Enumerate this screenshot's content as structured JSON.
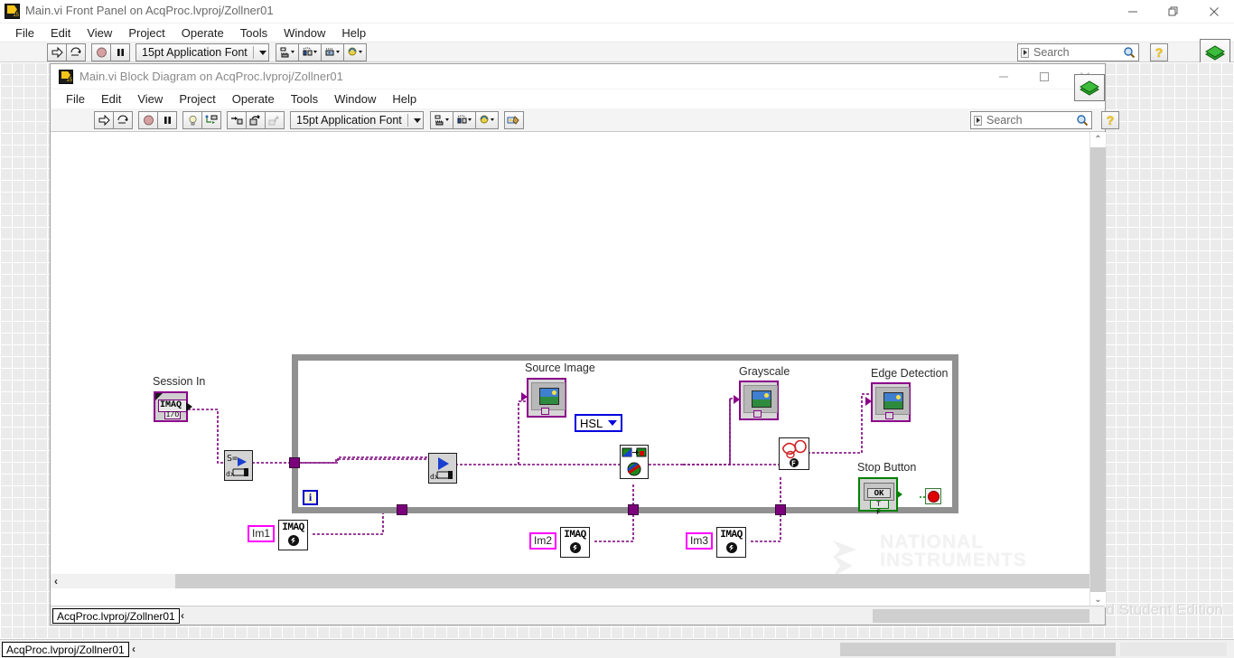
{
  "front_panel_window": {
    "title": "Main.vi Front Panel on AcqProc.lvproj/Zollner01",
    "icon": "labview-vi-icon",
    "window_controls": {
      "minimize": "minimize-icon",
      "restore": "restore-icon",
      "close": "close-icon"
    },
    "menu": [
      "File",
      "Edit",
      "View",
      "Project",
      "Operate",
      "Tools",
      "Window",
      "Help"
    ],
    "toolbar": {
      "buttons": [
        "run-button",
        "run-continuously-button",
        "abort-execution-button",
        "pause-button"
      ],
      "font_selector": "15pt Application Font",
      "align_objects": "align-objects-button",
      "distribute_objects": "distribute-objects-button",
      "resize_objects": "resize-objects-button",
      "reorder_objects": "reorder-objects-button"
    },
    "search": {
      "placeholder": "Search"
    },
    "help_button": "?",
    "context_help_button": "context-help-book-icon",
    "status_path": "AcqProc.lvproj/Zollner01",
    "status_chevron": "‹",
    "watermark": "LabVIEW™ Home and Student Edition"
  },
  "block_diagram_window": {
    "title": "Main.vi Block Diagram on AcqProc.lvproj/Zollner01",
    "icon": "labview-vi-icon",
    "window_controls": {
      "minimize": "minimize-icon",
      "maximize": "maximize-icon",
      "close": "close-icon"
    },
    "menu": [
      "File",
      "Edit",
      "View",
      "Project",
      "Operate",
      "Tools",
      "Window",
      "Help"
    ],
    "toolbar": {
      "buttons": [
        "run-button",
        "run-continuously-button",
        "abort-execution-button",
        "pause-button",
        "highlight-execution-button",
        "retain-wire-values-button",
        "step-into-button",
        "step-over-button",
        "step-out-button"
      ],
      "font_selector": "15pt Application Font",
      "align_objects": "align-objects-button",
      "distribute_objects": "distribute-objects-button",
      "reorder_objects": "reorder-objects-button",
      "clean_up_diagram": "clean-up-diagram-button"
    },
    "search": {
      "placeholder": "Search"
    },
    "help_button": "?",
    "context_help_button": "context-help-book-icon",
    "status_path": "AcqProc.lvproj/Zollner01",
    "status_chevron": "‹",
    "watermark_line1": "NATIONAL",
    "watermark_line2": "INSTRUMENTS",
    "watermark_line3": "LabVIEW™ Home and Student Edition",
    "scroll": {
      "up_arrow": "⌃",
      "down_arrow": "⌄",
      "left_chevron": "‹"
    }
  },
  "diagram": {
    "labels": {
      "session_in": "Session In",
      "source_image": "Source Image",
      "grayscale": "Grayscale",
      "edge_detection": "Edge Detection",
      "stop_button": "Stop Button"
    },
    "session_control": {
      "text": "IMAQ",
      "subtext": "I/O"
    },
    "iteration_terminal": "i",
    "enum_constant": {
      "value": "HSL"
    },
    "string_constants": [
      "Im1",
      "Im2",
      "Im3"
    ],
    "imaq_create_nodes": [
      {
        "text": "IMAQ"
      },
      {
        "text": "IMAQ"
      },
      {
        "text": "IMAQ"
      }
    ],
    "boolean_control": {
      "face_label": "OK",
      "type_label": "T F"
    },
    "nodes": {
      "grab_acquire": "imaq-grab-acquire-vi",
      "grab_in_loop": "imaq-grab-vi",
      "color_convert": "imaq-color-conversion-vi",
      "edge_find": "imaq-edge-detection-vi",
      "stop_terminal": "stop-terminal"
    },
    "colors": {
      "wire_imaq": "#7b007b",
      "wire_boolean": "#008000",
      "loop_border": "#919191",
      "enum_border": "#0000dd",
      "string_border": "#ff00ff",
      "control_border": "#8a008a"
    }
  }
}
